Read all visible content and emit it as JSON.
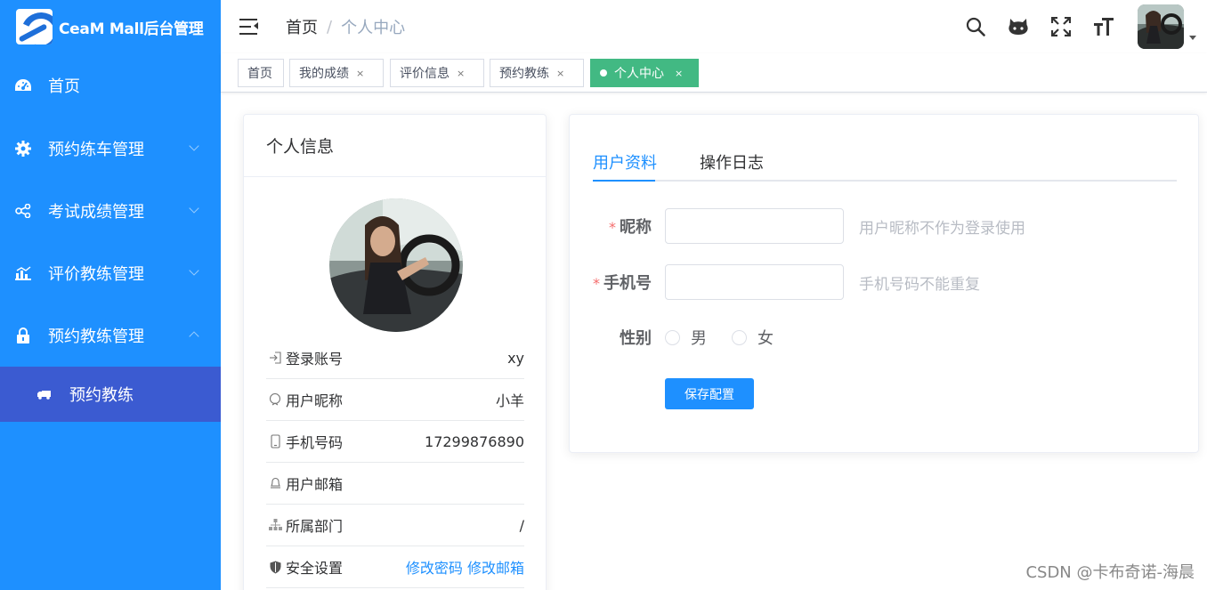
{
  "app": {
    "title": "CeaM Mall后台管理"
  },
  "sidebar": {
    "items": [
      {
        "label": "首页",
        "icon": "dashboard-icon"
      },
      {
        "label": "预约练车管理",
        "icon": "gear-icon"
      },
      {
        "label": "考试成绩管理",
        "icon": "share-icon"
      },
      {
        "label": "评价教练管理",
        "icon": "bar-chart-icon"
      },
      {
        "label": "预约教练管理",
        "icon": "lock-icon",
        "expanded": true
      }
    ],
    "subitems": [
      {
        "label": "预约教练",
        "icon": "truck-icon"
      }
    ]
  },
  "header": {
    "breadcrumb": {
      "home": "首页",
      "sep": "/",
      "current": "个人中心"
    }
  },
  "tags": [
    {
      "label": "首页",
      "closable": false,
      "active": false
    },
    {
      "label": "我的成绩",
      "closable": true,
      "active": false
    },
    {
      "label": "评价信息",
      "closable": true,
      "active": false
    },
    {
      "label": "预约教练",
      "closable": true,
      "active": false
    },
    {
      "label": "个人中心",
      "closable": true,
      "active": true
    }
  ],
  "tag_close": "×",
  "profile": {
    "title": "个人信息",
    "rows": [
      {
        "label": "登录账号",
        "value": "xy"
      },
      {
        "label": "用户昵称",
        "value": "小羊"
      },
      {
        "label": "手机号码",
        "value": "17299876890"
      },
      {
        "label": "用户邮箱",
        "value": ""
      },
      {
        "label": "所属部门",
        "value": "/"
      },
      {
        "label": "安全设置",
        "links": [
          "修改密码",
          "修改邮箱"
        ]
      }
    ]
  },
  "form": {
    "tabs": [
      "用户资料",
      "操作日志"
    ],
    "nickname": {
      "label": "昵称",
      "value": "",
      "hint": "用户昵称不作为登录使用"
    },
    "phone": {
      "label": "手机号",
      "value": "",
      "hint": "手机号码不能重复"
    },
    "gender": {
      "label": "性别",
      "options": [
        "男",
        "女"
      ]
    },
    "required_mark": "*",
    "save_label": "保存配置"
  },
  "watermark": "CSDN @卡布奇诺-海晨",
  "colors": {
    "sidebar": "#1e90ff",
    "submenu_active": "#3b5bd1",
    "tag_active": "#42b983",
    "primary": "#1e90ff"
  }
}
